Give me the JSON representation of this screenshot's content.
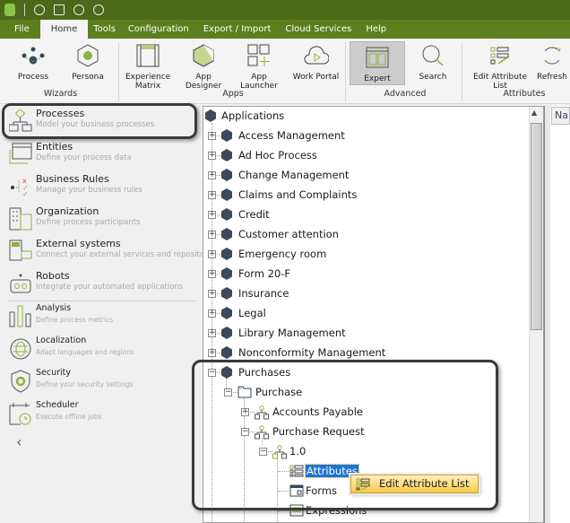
{
  "title_bar": {
    "quick_access_icons": [
      "bizagi-logo-icon",
      "process-wizard-icon",
      "layout-icon",
      "download-icon",
      "upload-icon"
    ]
  },
  "menu": {
    "tabs": [
      "File",
      "Home",
      "Tools",
      "Configuration",
      "Export / Import",
      "Cloud Services",
      "Help"
    ],
    "active": "Home"
  },
  "ribbon": {
    "buttons": {
      "process": "Process",
      "persona": "Persona",
      "experience_matrix_1": "Experience",
      "experience_matrix_2": "Matrix",
      "app_designer": "App Designer",
      "app_launcher": "App Launcher",
      "work_portal": "Work Portal",
      "expert": "Expert",
      "search": "Search",
      "edit_attribute_list": "Edit Attribute List",
      "refresh": "Refresh"
    },
    "groups": {
      "wizards": "Wizards",
      "apps": "Apps",
      "advanced": "Advanced",
      "attributes": "Attributes"
    },
    "active_button": "Expert"
  },
  "sidebar": {
    "items": [
      {
        "title": "Processes",
        "desc": "Model your business processes"
      },
      {
        "title": "Entities",
        "desc": "Define your process data"
      },
      {
        "title": "Business Rules",
        "desc": "Manage your business rules"
      },
      {
        "title": "Organization",
        "desc": "Define process participants"
      },
      {
        "title": "External systems",
        "desc": "Connect your external services and repositories"
      },
      {
        "title": "Robots",
        "desc": "Integrate your automated applications"
      },
      {
        "title": "Analysis",
        "desc": "Define process metrics"
      },
      {
        "title": "Localization",
        "desc": "Adapt languages and regions"
      },
      {
        "title": "Security",
        "desc": "Define your security settings"
      },
      {
        "title": "Scheduler",
        "desc": "Execute offline jobs"
      }
    ],
    "collapse_icon": "chevron-left-icon"
  },
  "tree": {
    "root": "Applications",
    "apps": [
      "Access Management",
      "Ad Hoc Process",
      "Change Management",
      "Claims and Complaints",
      "Credit",
      "Customer attention",
      "Emergency room",
      "Form 20-F",
      "Insurance",
      "Legal",
      "Library Management",
      "Nonconformity Management",
      "Purchases"
    ],
    "purchase_folder": "Purchase",
    "processes": [
      "Accounts Payable",
      "Purchase Request"
    ],
    "version": "1.0",
    "version_children": [
      "Attributes",
      "Forms",
      "Expressions"
    ],
    "selected": "Attributes"
  },
  "right_panel": {
    "column_header": "Name"
  },
  "context_menu": {
    "item": "Edit Attribute List"
  },
  "colors": {
    "title_bar": "#4b6a19",
    "menu_bar": "#5a7f1e",
    "accent_green": "#8db33a",
    "selection": "#1c73d8",
    "context_highlight": "#f7c948"
  }
}
